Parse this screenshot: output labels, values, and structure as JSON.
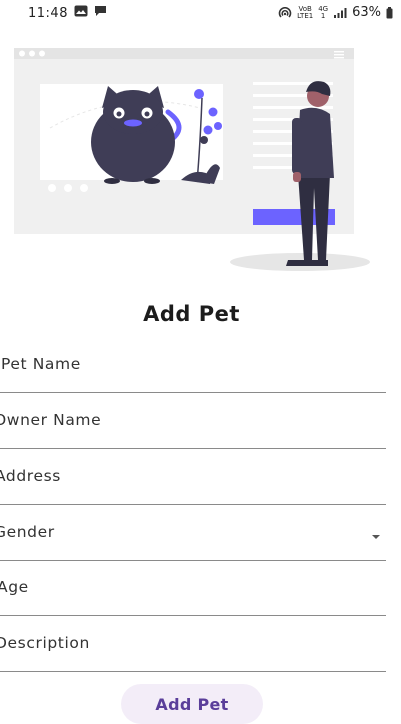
{
  "status_bar": {
    "time": "11:48",
    "network_small_top": "VoB",
    "network_small_bottom": "LTE1",
    "network_4g_top": "4G",
    "network_4g_bottom": "1",
    "battery": "63%"
  },
  "form": {
    "title": "Add Pet",
    "fields": [
      {
        "label": "Pet Name"
      },
      {
        "label": "Owner Name"
      },
      {
        "label": "Address"
      },
      {
        "label": "Gender"
      },
      {
        "label": "Age"
      },
      {
        "label": "Description"
      }
    ],
    "submit_label": "Add Pet"
  },
  "colors": {
    "accent": "#6c63ff",
    "button_bg": "#f3edf8",
    "button_text": "#5a3e9a",
    "illustration_bg": "#f0f0f0",
    "cat": "#3f3d56"
  }
}
